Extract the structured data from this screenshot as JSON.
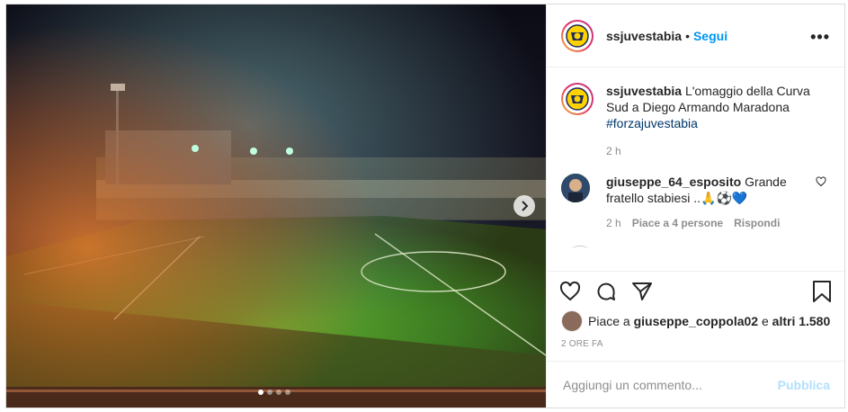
{
  "post": {
    "dots_count": 4,
    "active_dot": 1
  },
  "header": {
    "username": "ssjuvestabia",
    "separator": "•",
    "follow_label": "Segui",
    "more_label": "•••"
  },
  "caption": {
    "username": "ssjuvestabia",
    "text": "L'omaggio della Curva Sud a Diego Armando Maradona",
    "hashtag": "#forzajuvestabia",
    "age": "2 h"
  },
  "comments": [
    {
      "username": "giuseppe_64_esposito",
      "text": "Grande fratello stabiesi ..🙏⚽💙",
      "age": "2 h",
      "likes": "Piace a 4 persone",
      "reply_label": "Rispondi"
    }
  ],
  "likes": {
    "prefix": "Piace a",
    "user": "giuseppe_coppola02",
    "connector": "e",
    "others": "altri 1.580"
  },
  "timestamp": "2 ORE FA",
  "add_comment": {
    "placeholder": "Aggiungi un commento...",
    "publish_label": "Pubblica"
  },
  "colors": {
    "link_blue": "#0095f6",
    "hashtag": "#00376b",
    "muted": "#8e8e8e",
    "publish_disabled": "#b2dffc"
  }
}
